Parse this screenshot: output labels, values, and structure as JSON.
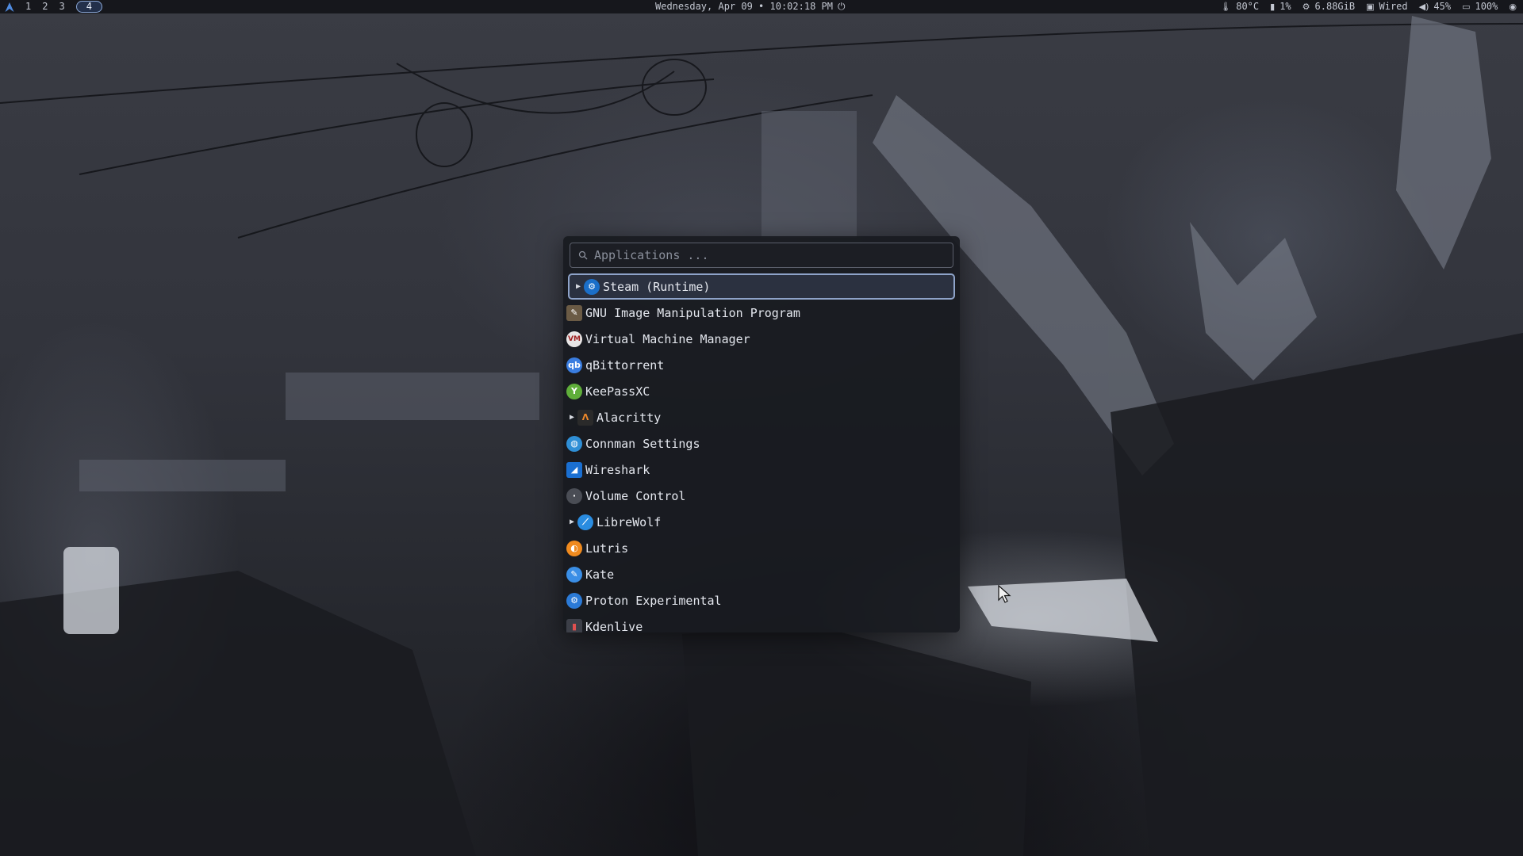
{
  "topbar": {
    "workspaces": [
      "1",
      "2",
      "3",
      "4"
    ],
    "active_workspace": "4",
    "datetime": "Wednesday, Apr 09 • 10:02:18 PM",
    "temperature": "80°C",
    "cpu": "1%",
    "memory": "6.88GiB",
    "network": "Wired",
    "volume": "45%",
    "battery": "100%"
  },
  "launcher": {
    "search_placeholder": "Applications ...",
    "items": [
      {
        "label": "Steam (Runtime)",
        "icon": "steam-icon",
        "expandable": true,
        "selected": true
      },
      {
        "label": "GNU Image Manipulation Program",
        "icon": "gimp-icon",
        "expandable": false
      },
      {
        "label": "Virtual Machine Manager",
        "icon": "virt-manager-icon",
        "expandable": false
      },
      {
        "label": "qBittorrent",
        "icon": "qbittorrent-icon",
        "expandable": false
      },
      {
        "label": "KeePassXC",
        "icon": "keepassxc-icon",
        "expandable": false
      },
      {
        "label": "Alacritty",
        "icon": "alacritty-icon",
        "expandable": true
      },
      {
        "label": "Connman Settings",
        "icon": "connman-icon",
        "expandable": false
      },
      {
        "label": "Wireshark",
        "icon": "wireshark-icon",
        "expandable": false
      },
      {
        "label": "Volume Control",
        "icon": "volume-control-icon",
        "expandable": false
      },
      {
        "label": "LibreWolf",
        "icon": "librewolf-icon",
        "expandable": true
      },
      {
        "label": "Lutris",
        "icon": "lutris-icon",
        "expandable": false
      },
      {
        "label": "Kate",
        "icon": "kate-icon",
        "expandable": false
      },
      {
        "label": "Proton Experimental",
        "icon": "proton-icon",
        "expandable": false
      },
      {
        "label": "Kdenlive",
        "icon": "kdenlive-icon",
        "expandable": false
      }
    ]
  },
  "colors": {
    "selection_border": "#8ea3c9",
    "selection_bg": "#2b3140",
    "launcher_bg": "#181a20",
    "topbar_bg": "#16171c",
    "text": "#e4e7ee"
  }
}
